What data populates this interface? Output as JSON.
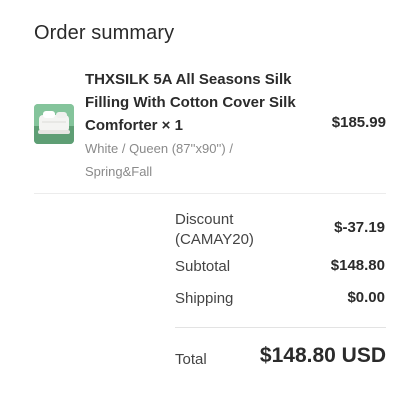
{
  "summary": {
    "title": "Order summary"
  },
  "product": {
    "image_icon": "comforter-product-image",
    "name": "THXSILK 5A All Seasons Silk Filling With Cotton Cover Silk Comforter × 1",
    "variant": "White / Queen (87''x90'') / Spring&Fall",
    "price": "$185.99"
  },
  "totals": {
    "discount_label": "Discount (CAMAY20)",
    "discount_value": "$-37.19",
    "subtotal_label": "Subtotal",
    "subtotal_value": "$148.80",
    "shipping_label": "Shipping",
    "shipping_value": "$0.00",
    "total_label": "Total",
    "total_value": "$148.80 USD"
  },
  "colors": {
    "text": "#2b2b2b",
    "muted": "#8a8a8a",
    "divider": "#ececec",
    "thumbnail_bg": "#7fbf95"
  }
}
